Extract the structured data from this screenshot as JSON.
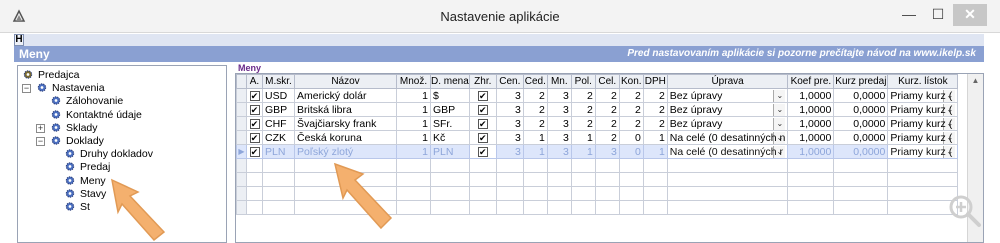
{
  "window": {
    "title": "Nastavenie aplikácie",
    "minimize_glyph": "—",
    "restore_glyph": "☐",
    "close_glyph": "✕"
  },
  "toolbar": {
    "h_label": "H"
  },
  "header": {
    "title": "Meny",
    "note": "Pred nastavovaním aplikácie si pozorne prečítajte návod na www.ikelp.sk"
  },
  "tree": {
    "items": [
      {
        "label": "Predajca",
        "level": 0,
        "expander": ""
      },
      {
        "label": "Nastavenia",
        "level": 0,
        "expander": "−"
      },
      {
        "label": "Zálohovanie",
        "level": 1,
        "expander": ""
      },
      {
        "label": "Kontaktné údaje",
        "level": 1,
        "expander": ""
      },
      {
        "label": "Sklady",
        "level": 1,
        "expander": "+"
      },
      {
        "label": "Doklady",
        "level": 1,
        "expander": "−"
      },
      {
        "label": "Druhy dokladov",
        "level": 2,
        "expander": ""
      },
      {
        "label": "Predaj",
        "level": 2,
        "expander": ""
      },
      {
        "label": "Meny",
        "level": 2,
        "expander": ""
      },
      {
        "label": "Stavy",
        "level": 2,
        "expander": ""
      },
      {
        "label": "St",
        "level": 2,
        "expander": ""
      }
    ]
  },
  "grid": {
    "label": "Meny",
    "columns": [
      "A.",
      "M.skr.",
      "Názov",
      "Množ.",
      "D. mena",
      "Zhr.",
      "Cen.",
      "Ced.",
      "Mn.",
      "Pol.",
      "Cel.",
      "Kon.",
      "DPH",
      "Úprava",
      "Koef pre.",
      "Kurz predaj",
      "Kurz. lístok"
    ],
    "rows": [
      {
        "a": true,
        "code": "USD",
        "name": "Americký dolár",
        "qty": "1",
        "symbol": "$",
        "zhr": true,
        "cen": "3",
        "ced": "2",
        "mn": "3",
        "pol": "2",
        "cel": "2",
        "kon": "2",
        "dph": "2",
        "uprava": "Bez úpravy",
        "koef": "1,0000",
        "kurz": "0,0000",
        "listok": "Priamy kurz ("
      },
      {
        "a": true,
        "code": "GBP",
        "name": "Britská libra",
        "qty": "1",
        "symbol": "GBP",
        "zhr": true,
        "cen": "3",
        "ced": "2",
        "mn": "3",
        "pol": "2",
        "cel": "2",
        "kon": "2",
        "dph": "2",
        "uprava": "Bez úpravy",
        "koef": "1,0000",
        "kurz": "0,0000",
        "listok": "Priamy kurz ("
      },
      {
        "a": true,
        "code": "CHF",
        "name": "Švajčiarsky frank",
        "qty": "1",
        "symbol": "SFr.",
        "zhr": true,
        "cen": "3",
        "ced": "2",
        "mn": "3",
        "pol": "2",
        "cel": "2",
        "kon": "2",
        "dph": "2",
        "uprava": "Bez úpravy",
        "koef": "1,0000",
        "kurz": "0,0000",
        "listok": "Priamy kurz ("
      },
      {
        "a": true,
        "code": "CZK",
        "name": "Česká koruna",
        "qty": "1",
        "symbol": "Kč",
        "zhr": true,
        "cen": "3",
        "ced": "1",
        "mn": "3",
        "pol": "1",
        "cel": "2",
        "kon": "0",
        "dph": "1",
        "uprava": "Na celé (0 desatinných n",
        "koef": "1,0000",
        "kurz": "0,0000",
        "listok": "Priamy kurz ("
      },
      {
        "a": true,
        "code": "PLN",
        "name": "Poľský zlotý",
        "qty": "1",
        "symbol": "PLN",
        "zhr": true,
        "cen": "3",
        "ced": "1",
        "mn": "3",
        "pol": "1",
        "cel": "3",
        "kon": "0",
        "dph": "1",
        "uprava": "Na celé (0 desatinných r",
        "koef": "1,0000",
        "kurz": "0,0000",
        "listok": "Priamy kurz ("
      }
    ],
    "empty_rows": 4,
    "dropdown_glyph": "⌄",
    "check_glyph": "✔",
    "row_pointer": "▶"
  },
  "icons": {
    "tree_gear_color": "#4a6fc1",
    "tree_root_color": "#7a6a30",
    "arrow_color": "#f4b06e"
  }
}
